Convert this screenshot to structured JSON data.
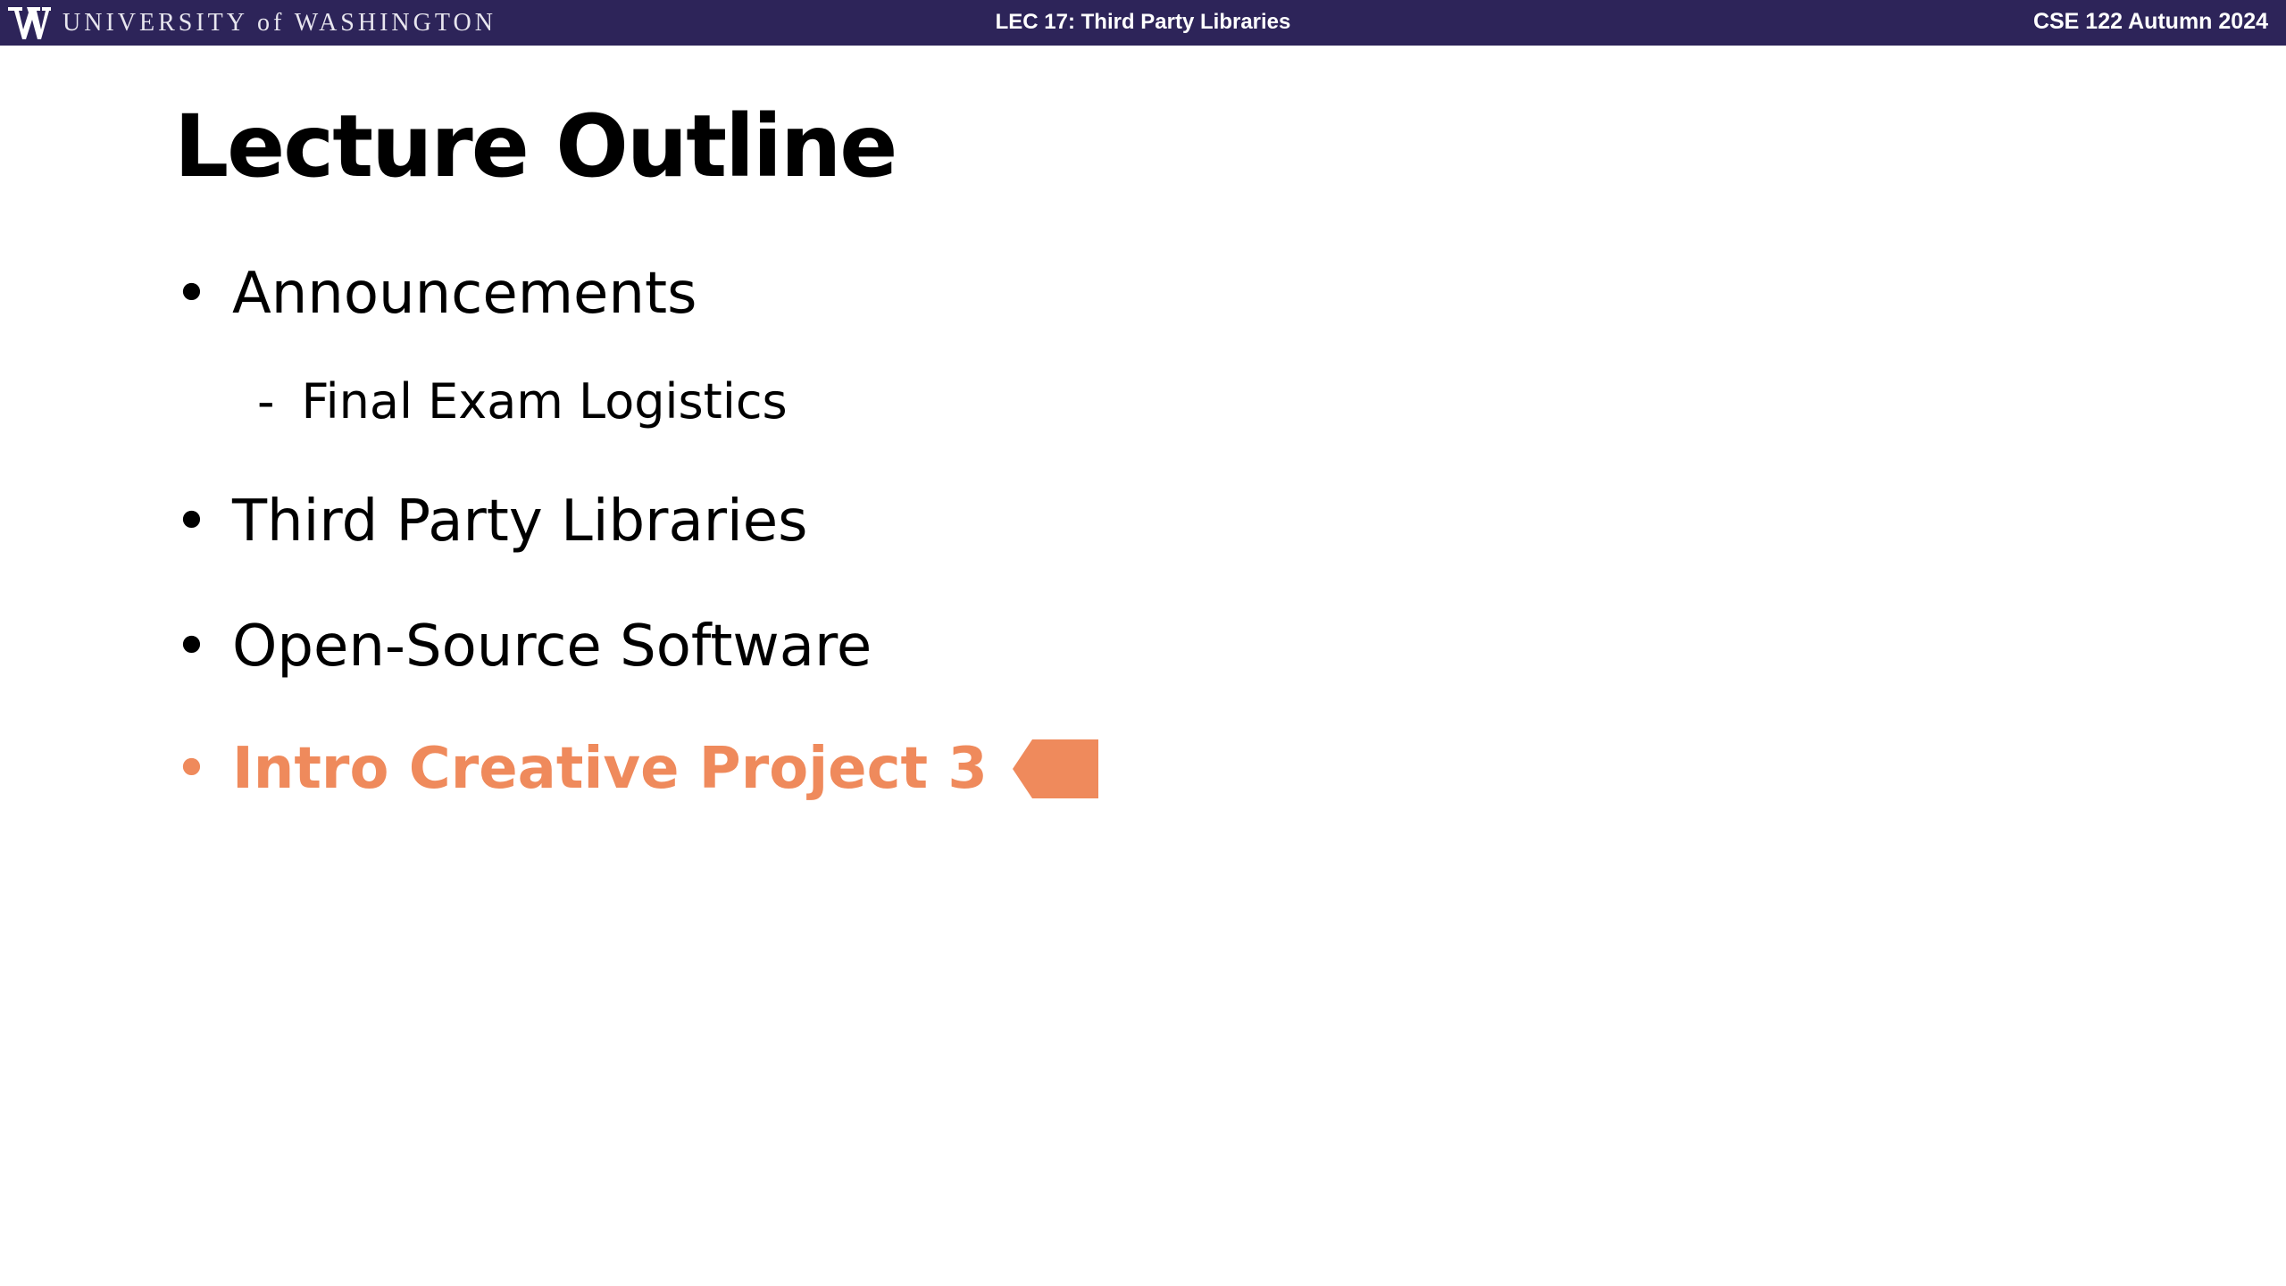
{
  "header": {
    "institution": "UNIVERSITY of WASHINGTON",
    "lecture": "LEC 17: Third Party Libraries",
    "course": "CSE 122 Autumn 2024"
  },
  "slide": {
    "title": "Lecture Outline",
    "items": [
      {
        "bullet": "•",
        "text": "Announcements",
        "level": 1
      },
      {
        "bullet": "-",
        "text": "Final Exam Logistics",
        "level": 2
      },
      {
        "bullet": "•",
        "text": "Third Party Libraries",
        "level": 1
      },
      {
        "bullet": "•",
        "text": "Open-Source Software",
        "level": 1
      },
      {
        "bullet": "•",
        "text": "Intro Creative Project 3",
        "level": 1,
        "highlighted": true
      }
    ],
    "current_marker_icon": "left-pointing-pentagon-arrow"
  },
  "colors": {
    "header_background": "#2d2459",
    "highlight": "#ef8a5c",
    "body_text": "#000000"
  }
}
